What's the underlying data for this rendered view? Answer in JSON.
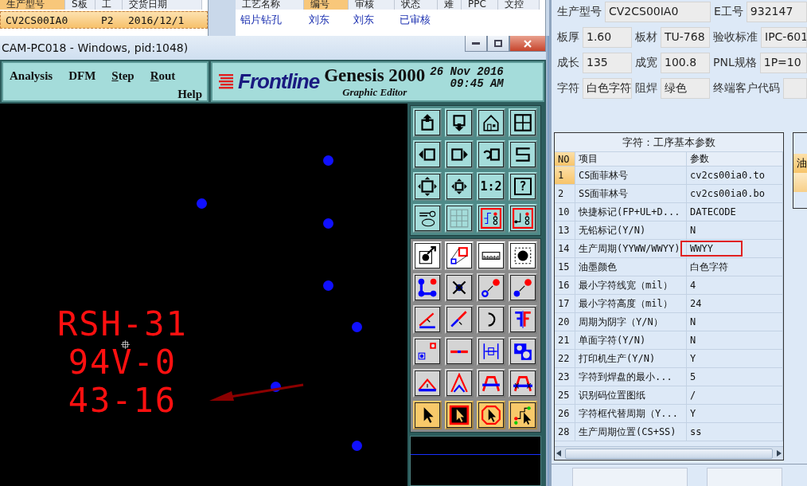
{
  "back_window": {
    "left_table": {
      "columns": [
        {
          "label": "生产型号",
          "highlighted": true
        },
        {
          "label": "S板",
          "highlighted": false
        },
        {
          "label": "工",
          "highlighted": false
        },
        {
          "label": "交货日期",
          "highlighted": false
        }
      ],
      "rows": [
        {
          "model": "CV2CS00IA0",
          "factory": "P2",
          "due": "2016/12/1",
          "selected": true
        }
      ]
    },
    "right_table": {
      "columns": [
        {
          "label": "工艺名称",
          "highlighted": false
        },
        {
          "label": "编号",
          "highlighted": true
        },
        {
          "label": "审核",
          "highlighted": false
        },
        {
          "label": "状态",
          "highlighted": false
        },
        {
          "label": "难",
          "highlighted": false
        },
        {
          "label": "PPC",
          "highlighted": false
        },
        {
          "label": "文控",
          "highlighted": false
        }
      ],
      "rows": [
        {
          "cells": [
            "铝片钻孔",
            "刘东",
            "刘东",
            "已审核"
          ]
        }
      ]
    }
  },
  "genesis": {
    "title": "CAM-PC018 - Windows, pid:1048)",
    "menu": [
      {
        "label": "Analysis",
        "mnemonic": false
      },
      {
        "label": "DFM",
        "mnemonic": false
      },
      {
        "label": "Step",
        "mnemonic": true
      },
      {
        "label": "Rout",
        "mnemonic": true
      },
      {
        "label": "Help",
        "mnemonic": false
      }
    ],
    "logo": "Frontline",
    "product": "Genesis 2000",
    "subtitle": "Graphic Editor",
    "date": "26 Nov 2016",
    "time": "09:45 AM",
    "canvas": {
      "text_lines": [
        "RSH-31",
        "94V-0",
        "43-16"
      ]
    },
    "toolbar": {
      "scale_button": "1:2",
      "help_button": "?"
    }
  },
  "form": {
    "rows": [
      [
        {
          "label": "生产型号",
          "value": "CV2CS00IA0"
        },
        "",
        {
          "label": "E工号",
          "value": "932147"
        }
      ],
      [
        {
          "label": "板厚",
          "value": "1.60"
        },
        {
          "label": "板材",
          "value": "TU-768"
        },
        {
          "label": "验收标准",
          "value": "IPC-601"
        }
      ],
      [
        {
          "label": "成长",
          "value": "135"
        },
        {
          "label": "成宽",
          "value": "100.8"
        },
        {
          "label": "PNL规格",
          "value": "1P=10"
        }
      ],
      [
        {
          "label": "字符",
          "value": "白色字符"
        },
        {
          "label": "阻焊",
          "value": "绿色"
        },
        {
          "label": "终端客户代码"
        }
      ]
    ]
  },
  "params": {
    "title": "字符：工序基本参数",
    "columns": [
      "NO",
      "项目",
      "参数"
    ],
    "rows": [
      {
        "no": "1",
        "item": "CS面菲林号",
        "value": "cv2cs00ia0.to",
        "selected": true,
        "highlighted": false
      },
      {
        "no": "2",
        "item": "SS面菲林号",
        "value": "cv2cs00ia0.bo",
        "selected": false,
        "highlighted": false
      },
      {
        "no": "10",
        "item": "快捷标记(FP+UL+D...",
        "value": "DATECODE",
        "selected": false,
        "highlighted": false
      },
      {
        "no": "13",
        "item": "无铅标记(Y/N)",
        "value": "N",
        "selected": false,
        "highlighted": false
      },
      {
        "no": "14",
        "item": "生产周期(YYWW/WWYY)",
        "value": "WWYY",
        "selected": false,
        "highlighted": true
      },
      {
        "no": "15",
        "item": "油墨颜色",
        "value": "白色字符",
        "selected": false,
        "highlighted": false
      },
      {
        "no": "16",
        "item": "最小字符线宽（mil）",
        "value": "4",
        "selected": false,
        "highlighted": false
      },
      {
        "no": "17",
        "item": "最小字符高度（mil）",
        "value": "24",
        "selected": false,
        "highlighted": false
      },
      {
        "no": "20",
        "item": "周期为阴字（Y/N）",
        "value": "N",
        "selected": false,
        "highlighted": false
      },
      {
        "no": "21",
        "item": "单面字符(Y/N)",
        "value": "N",
        "selected": false,
        "highlighted": false
      },
      {
        "no": "22",
        "item": "打印机生产(Y/N)",
        "value": "Y",
        "selected": false,
        "highlighted": false
      },
      {
        "no": "23",
        "item": "字符到焊盘的最小...",
        "value": "5",
        "selected": false,
        "highlighted": false
      },
      {
        "no": "25",
        "item": "识别码位置图纸",
        "value": "/",
        "selected": false,
        "highlighted": false
      },
      {
        "no": "26",
        "item": "字符框代替周期（Y...",
        "value": "Y",
        "selected": false,
        "highlighted": false
      },
      {
        "no": "28",
        "item": "生产周期位置(CS+SS)",
        "value": "ss",
        "selected": false,
        "highlighted": false
      }
    ]
  },
  "side_table": {
    "column": "油"
  }
}
